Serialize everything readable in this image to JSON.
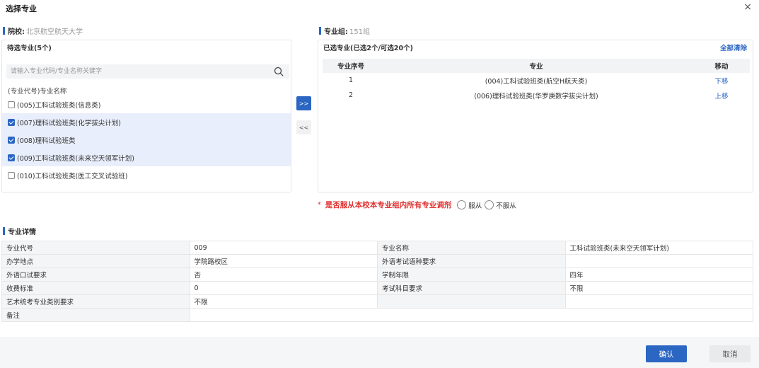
{
  "dialog": {
    "title": "选择专业",
    "close_glyph": "×"
  },
  "school": {
    "label": "院校:",
    "value": "北京航空航天大学"
  },
  "group": {
    "label": "专业组:",
    "value": "151组"
  },
  "candidates": {
    "header": "待选专业(5个)",
    "search_placeholder": "请输入专业代码/专业名称关键字",
    "list_header": "(专业代号)专业名称",
    "items": [
      {
        "label": "(005)工科试验班类(信息类)",
        "checked": false
      },
      {
        "label": "(007)理科试验班类(化学拔尖计划)",
        "checked": true
      },
      {
        "label": "(008)理科试验班类",
        "checked": true
      },
      {
        "label": "(009)工科试验班类(未来空天领军计划)",
        "checked": true
      },
      {
        "label": "(010)工科试验班类(医工交叉试验班)",
        "checked": false
      }
    ]
  },
  "transfer": {
    "add": ">>",
    "remove": "<<"
  },
  "selected": {
    "header": "已选专业(已选2个/可选20个)",
    "clear_all": "全部清除",
    "columns": [
      "专业序号",
      "专业",
      "移动"
    ],
    "rows": [
      {
        "index": "1",
        "name": "(004)工科试验班类(航空H航天类)",
        "move": "下移"
      },
      {
        "index": "2",
        "name": "(006)理科试验班类(华罗庚数学拔尖计划)",
        "move": "上移"
      }
    ]
  },
  "adjust": {
    "star": "*",
    "question": "是否服从本校本专业组内所有专业调剂",
    "options": [
      "服从",
      "不服从"
    ]
  },
  "details": {
    "title": "专业详情",
    "rows": [
      [
        "专业代号",
        "009",
        "专业名称",
        "工科试验班类(未来空天领军计划)"
      ],
      [
        "办学地点",
        "学院路校区",
        "外语考试语种要求",
        ""
      ],
      [
        "外语口试要求",
        "否",
        "学制年限",
        "四年"
      ],
      [
        "收费标准",
        "0",
        "考试科目要求",
        "不限"
      ],
      [
        "艺术统考专业类别要求",
        "不限",
        "",
        ""
      ]
    ],
    "remark_label": "备注",
    "remark_value": ""
  },
  "footer": {
    "confirm": "确认",
    "cancel": "取消"
  },
  "colors": {
    "accent": "#2b66c3",
    "warning": "#e03030",
    "selected_row": "#e8eefb"
  }
}
